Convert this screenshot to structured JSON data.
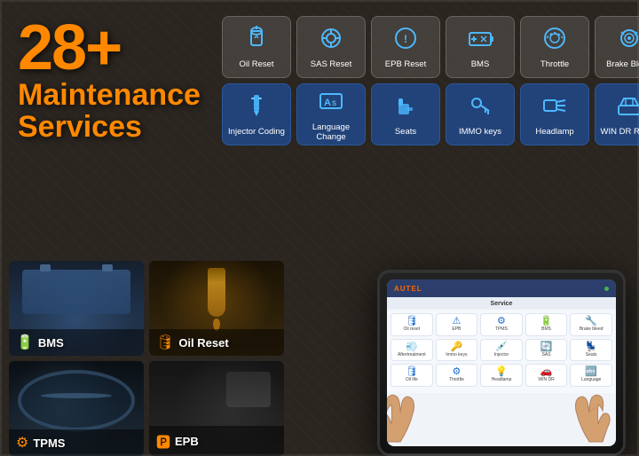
{
  "title": "28+ Maintenance Services",
  "big_number": "28+",
  "line1": "Maintenance",
  "line2": "Services",
  "brand": "AUTEL",
  "service_label": "Service",
  "service_tiles_row1": [
    {
      "id": "oil-reset",
      "label": "Oil Reset",
      "icon": "🛢"
    },
    {
      "id": "sas-reset",
      "label": "SAS Reset",
      "icon": "🔄"
    },
    {
      "id": "epb-reset",
      "label": "EPB Reset",
      "icon": "⚠"
    },
    {
      "id": "bms",
      "label": "BMS",
      "icon": "🔋"
    },
    {
      "id": "throttle",
      "label": "Throttle",
      "icon": "⚙"
    },
    {
      "id": "brake-bleed",
      "label": "Brake Bleed",
      "icon": "🔧"
    }
  ],
  "service_tiles_row2": [
    {
      "id": "injector-coding",
      "label": "Injector Coding",
      "icon": "💉"
    },
    {
      "id": "language-change",
      "label": "Language Change",
      "icon": "🔤"
    },
    {
      "id": "seats",
      "label": "Seats",
      "icon": "💺"
    },
    {
      "id": "immo-keys",
      "label": "IMMO keys",
      "icon": "🔑"
    },
    {
      "id": "headlamp",
      "label": "Headlamp",
      "icon": "💡"
    },
    {
      "id": "win-dr-roof",
      "label": "WIN DR ROOF",
      "icon": "🚗"
    }
  ],
  "thumb_items": [
    {
      "id": "bms",
      "label": "BMS",
      "icon": "🔋"
    },
    {
      "id": "oil-reset",
      "label": "Oil Reset",
      "icon": "🛢"
    },
    {
      "id": "tpms",
      "label": "TPMS",
      "icon": "⚙"
    },
    {
      "id": "epb",
      "label": "EPB",
      "icon": "🅿"
    }
  ],
  "tablet": {
    "brand": "AUTEL",
    "screen_title": "Service",
    "icon_rows": [
      [
        {
          "label": "Oil reset",
          "icon": "🛢"
        },
        {
          "label": "EPB",
          "icon": "⚠"
        },
        {
          "label": "TPMS",
          "icon": "⚙"
        },
        {
          "label": "BMS",
          "icon": "🔋"
        },
        {
          "label": "Brake bleed",
          "icon": "🔧"
        }
      ],
      [
        {
          "label": "Aftertreatment",
          "icon": "💨"
        },
        {
          "label": "Immo keys",
          "icon": "🔑"
        },
        {
          "label": "Injector",
          "icon": "💉"
        },
        {
          "label": "SAS",
          "icon": "🔄"
        },
        {
          "label": "Seats",
          "icon": "💺"
        }
      ],
      [
        {
          "label": "Oil life",
          "icon": "🛢"
        },
        {
          "label": "Throttle",
          "icon": "⚙"
        },
        {
          "label": "Headlamp",
          "icon": "💡"
        },
        {
          "label": "WIN DR",
          "icon": "🚗"
        },
        {
          "label": "Language",
          "icon": "🔤"
        }
      ]
    ]
  }
}
